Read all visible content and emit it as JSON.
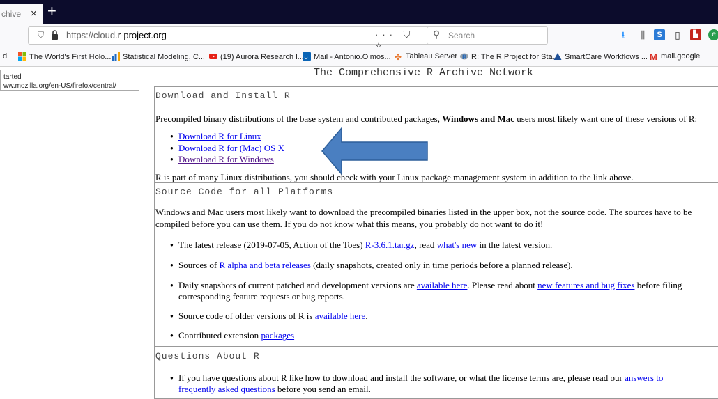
{
  "browser": {
    "tab_title": "chive",
    "tab_close": "×",
    "new_tab": "+",
    "url_prefix": "https://cloud.",
    "url_domain": "r-project.org",
    "page_actions": "··· ⛉ ☆",
    "search_placeholder": "Search",
    "toolbar_icons": [
      "download-icon",
      "library-icon",
      "s-extension-icon",
      "reader-icon",
      "pdf-icon",
      "extension-icon"
    ]
  },
  "bookmarks": [
    {
      "label": "d",
      "icon": "none"
    },
    {
      "label": "The World's First Holo...",
      "icon": "windows-tiles-icon",
      "color": "#f35325"
    },
    {
      "label": "Statistical Modeling, C...",
      "icon": "bar-chart-icon",
      "color": "#1e6ac4"
    },
    {
      "label": "(19) Aurora Research l...",
      "icon": "youtube-icon",
      "color": "#e62117"
    },
    {
      "label": "Mail - Antonio.Olmos...",
      "icon": "outlook-icon",
      "color": "#0a64b5"
    },
    {
      "label": "Tableau Server",
      "icon": "tableau-icon",
      "color": "#e8762d"
    },
    {
      "label": "R: The R Project for Sta...",
      "icon": "r-logo-icon",
      "color": "#2266b8"
    },
    {
      "label": "SmartCare Workflows ...",
      "icon": "triangle-icon",
      "color": "#1e4f96"
    },
    {
      "label": "mail.google",
      "icon": "gmail-icon",
      "color": "#d93025"
    }
  ],
  "status_tip": {
    "line1": "tarted",
    "line2": "ww.mozilla.org/en-US/firefox/central/"
  },
  "page": {
    "heading": "The Comprehensive R Archive Network",
    "download_box": {
      "title": "Download and Install R",
      "intro_a": "Precompiled binary distributions of the base system and contributed packages, ",
      "intro_bold": "Windows and Mac",
      "intro_b": " users most likely want one of these versions of R:",
      "links": [
        "Download R for Linux",
        "Download R for (Mac) OS X",
        "Download R for Windows"
      ],
      "footer": "R is part of many Linux distributions, you should check with your Linux package management system in addition to the link above."
    },
    "source_box": {
      "title": "Source Code for all Platforms",
      "para_line1": "Windows and Mac users most likely want to download the precompiled binaries listed in the upper box, not the source code. The sources have to be",
      "para_line2": "compiled before you can use them. If you do not know what this means, you probably do not want to do it!",
      "item1_a": "The latest release (2019-07-05, Action of the Toes) ",
      "item1_link": "R-3.6.1.tar.gz",
      "item1_b": ", read ",
      "item1_link2": "what's new",
      "item1_c": " in the latest version.",
      "item2_a": "Sources of ",
      "item2_link": "R alpha and beta releases",
      "item2_b": " (daily snapshots, created only in time periods before a planned release).",
      "item3_a": "Daily snapshots of current patched and development versions are ",
      "item3_link": "available here",
      "item3_b": ". Please read about ",
      "item3_link2": "new features and bug fixes",
      "item3_c": " before filing",
      "item3_line2": "corresponding feature requests or bug reports.",
      "item4_a": "Source code of older versions of R is ",
      "item4_link": "available here",
      "item4_b": ".",
      "item5_a": "Contributed extension ",
      "item5_link": "packages"
    },
    "questions_box": {
      "title": "Questions About R",
      "item1_a": "If you have questions about R like how to download and install the software, or what the license terms are, please read our ",
      "item1_link": "answers to",
      "item1_link_line2": "frequently asked questions",
      "item1_b": " before you send an email."
    },
    "annotation_arrow_color": "#4a7fc1"
  }
}
